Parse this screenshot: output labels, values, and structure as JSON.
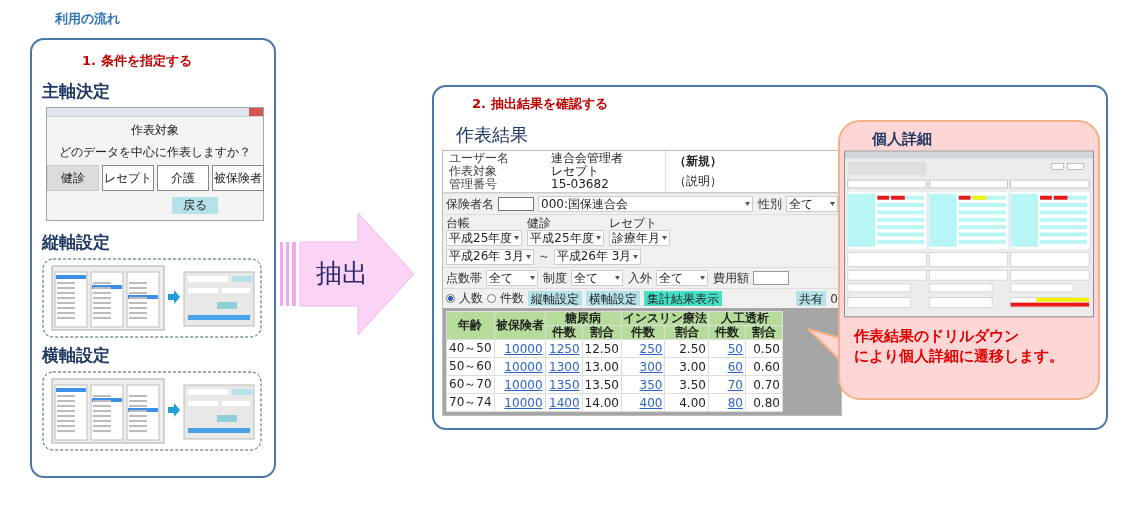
{
  "page_title": "利用の流れ",
  "step1": {
    "heading": "1. 条件を指定する",
    "main_axis": {
      "heading": "主軸決定",
      "dialog": {
        "title": "作表対象",
        "question": "どのデータを中心に作表しますか？",
        "options": [
          {
            "label": "健診",
            "selected": true
          },
          {
            "label": "レセプト",
            "selected": false
          },
          {
            "label": "介護",
            "selected": false
          },
          {
            "label": "被保険者",
            "selected": false
          }
        ],
        "back_button": "戻る"
      }
    },
    "vertical_axis": {
      "heading": "縦軸設定"
    },
    "horizontal_axis": {
      "heading": "横軸設定"
    }
  },
  "extract_arrow": {
    "label": "抽出"
  },
  "step2": {
    "heading": "2. 抽出結果を確認する",
    "result": {
      "heading": "作表結果",
      "info": [
        {
          "label": "ユーザー名",
          "value": "連合会管理者"
        },
        {
          "label": "作表対象",
          "value": "レセプト"
        },
        {
          "label": "管理番号",
          "value": "15-03682"
        }
      ],
      "status": "（新規）",
      "note": "（説明）",
      "filter_rows": [
        {
          "stacked": false,
          "fields": [
            {
              "kind": "coded_select",
              "label": "保険者名",
              "value": "000:国保連合会"
            },
            {
              "kind": "select",
              "label": "性別",
              "value": "全て"
            }
          ]
        },
        {
          "stacked": true,
          "fields": [
            {
              "kind": "select",
              "label": "台帳",
              "value": "平成25年度"
            },
            {
              "kind": "select",
              "label": "健診",
              "value": "平成25年度"
            },
            {
              "kind": "select",
              "label": "レセプト",
              "value": "診療年月"
            },
            {
              "kind": "range",
              "from": "平成26年 3月",
              "separator": "～",
              "to": "平成26年 3月"
            }
          ]
        },
        {
          "stacked": false,
          "fields": [
            {
              "kind": "select",
              "label": "点数帯",
              "value": "全て"
            },
            {
              "kind": "select",
              "label": "制度",
              "value": "全て"
            },
            {
              "kind": "select",
              "label": "入外",
              "value": "全て"
            },
            {
              "kind": "input",
              "label": "費用額"
            }
          ]
        }
      ],
      "count_mode": [
        {
          "label": "人数",
          "selected": true
        },
        {
          "label": "件数",
          "selected": false
        }
      ],
      "buttons": [
        {
          "label": "縦軸設定",
          "kind": "plain"
        },
        {
          "label": "横軸設定",
          "kind": "plain"
        },
        {
          "label": "集計結果表示",
          "kind": "primary"
        },
        {
          "label": "共有",
          "kind": "plain"
        }
      ],
      "edge_text": "0",
      "table": {
        "header_rows": [
          [
            {
              "label": "年齢",
              "rowspan": 2
            },
            {
              "label": "被保険者",
              "rowspan": 2
            },
            {
              "label": "糖尿病",
              "colspan": 2
            },
            {
              "label": "インスリン療法",
              "colspan": 2
            },
            {
              "label": "人工透析",
              "colspan": 2
            }
          ],
          [
            {
              "label": "件数"
            },
            {
              "label": "割合"
            },
            {
              "label": "件数"
            },
            {
              "label": "割合"
            },
            {
              "label": "件数"
            },
            {
              "label": "割合"
            }
          ]
        ],
        "rows": [
          [
            {
              "text": "40～50",
              "link": false
            },
            {
              "text": "10000",
              "link": true
            },
            {
              "text": "1250",
              "link": true
            },
            {
              "text": "12.50",
              "link": false
            },
            {
              "text": "250",
              "link": true
            },
            {
              "text": "2.50",
              "link": false
            },
            {
              "text": "50",
              "link": true
            },
            {
              "text": "0.50",
              "link": false
            }
          ],
          [
            {
              "text": "50～60",
              "link": false
            },
            {
              "text": "10000",
              "link": true
            },
            {
              "text": "1300",
              "link": true
            },
            {
              "text": "13.00",
              "link": false
            },
            {
              "text": "300",
              "link": true
            },
            {
              "text": "3.00",
              "link": false
            },
            {
              "text": "60",
              "link": true
            },
            {
              "text": "0.60",
              "link": false
            }
          ],
          [
            {
              "text": "60～70",
              "link": false
            },
            {
              "text": "10000",
              "link": true
            },
            {
              "text": "1350",
              "link": true
            },
            {
              "text": "13.50",
              "link": false
            },
            {
              "text": "350",
              "link": true
            },
            {
              "text": "3.50",
              "link": false
            },
            {
              "text": "70",
              "link": true
            },
            {
              "text": "0.70",
              "link": false
            }
          ],
          [
            {
              "text": "70～74",
              "link": false
            },
            {
              "text": "10000",
              "link": true
            },
            {
              "text": "1400",
              "link": true
            },
            {
              "text": "14.00",
              "link": false
            },
            {
              "text": "400",
              "link": true
            },
            {
              "text": "4.00",
              "link": false
            },
            {
              "text": "80",
              "link": true
            },
            {
              "text": "0.80",
              "link": false
            }
          ]
        ]
      }
    }
  },
  "detail_callout": {
    "heading": "個人詳細",
    "message_lines": [
      "作表結果のドリルダウン",
      "により個人詳細に遷移します。"
    ]
  }
}
